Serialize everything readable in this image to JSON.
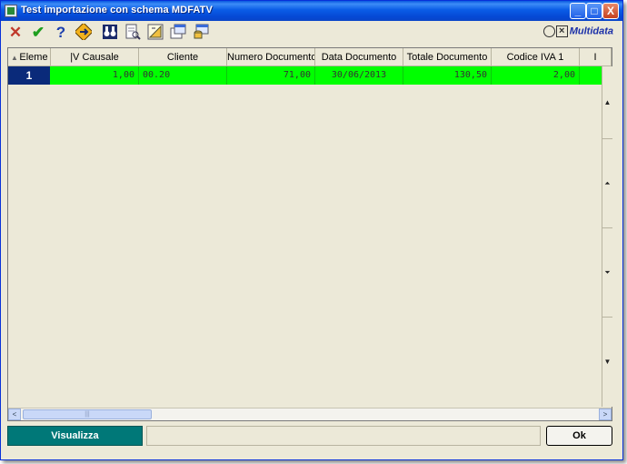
{
  "window": {
    "title": "Test importazione con schema MDFATV"
  },
  "titlebar": {
    "min_glyph": "_",
    "max_glyph": "□",
    "close_glyph": "X"
  },
  "toolbar": {
    "cancel_glyph": "✕",
    "confirm_glyph": "✔",
    "help_glyph": "?",
    "logo_text": "Multidata",
    "accent_colors": {
      "cancel": "#c0392b",
      "confirm": "#1e9e1e",
      "help": "#1c3fae"
    }
  },
  "grid": {
    "sort_mark": "▲",
    "columns": [
      "Eleme",
      "|V Causale",
      "Cliente",
      "Numero Documento",
      "Data Documento",
      "Totale Documento",
      "Codice IVA 1",
      "I"
    ],
    "rows": [
      {
        "index": "1",
        "causale": "1,00",
        "cliente": "00.20",
        "numero": "71,00",
        "data": "30/06/2013",
        "totale": "130,50",
        "codice_iva": "2,00"
      }
    ],
    "row_color": "#00ff00",
    "row_header_color": "#0a2a7a"
  },
  "scroll": {
    "up": "▲",
    "down": "▼",
    "left": "<",
    "right": ">",
    "thumb_grip": "|||"
  },
  "footer": {
    "visualizza_label": "Visualizza",
    "ok_label": "Ok",
    "status_text": ""
  }
}
